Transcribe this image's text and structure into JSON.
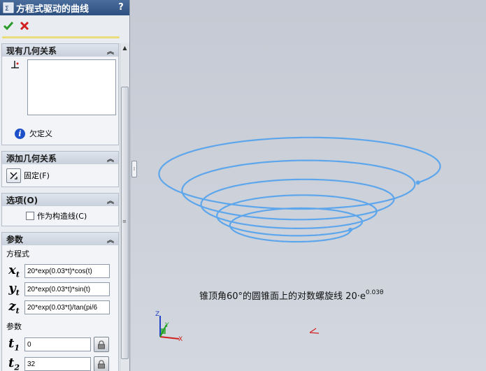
{
  "panel": {
    "title": "方程式驱动的曲线",
    "title_icon": "equation-curve-icon",
    "help": "?",
    "actions": {
      "ok_icon": "checkmark-icon",
      "cancel_icon": "x-icon"
    }
  },
  "groups": {
    "existing_relations": {
      "title": "现有几何关系",
      "status": "欠定义"
    },
    "add_relations": {
      "title": "添加几何关系",
      "fix_label": "固定(F)"
    },
    "options": {
      "title": "选项(O)",
      "construction_label": "作为构造线(C)",
      "construction_checked": false
    },
    "parameters": {
      "title": "参数",
      "equation_label": "方程式",
      "x_var": "x",
      "x_sub": "t",
      "y_var": "y",
      "y_sub": "t",
      "z_var": "z",
      "z_sub": "t",
      "xt": "20*exp(0.03*t)*cos(t)",
      "yt": "20*exp(0.03*t)*sin(t)",
      "zt": "20*exp(0.03*t)/tan(pi/6",
      "params_label": "参数",
      "t1_var": "t",
      "t1_sub": "1",
      "t2_var": "t",
      "t2_sub": "2",
      "t1": "0",
      "t2": "32"
    }
  },
  "viewport": {
    "caption": "锥顶角60°的圆锥面上的对数螺旋线 20·e",
    "caption_exp": "0.03θ",
    "triad": {
      "x": "X",
      "y": "Y",
      "z": "Z"
    },
    "curve_color": "#5ea6ec"
  }
}
